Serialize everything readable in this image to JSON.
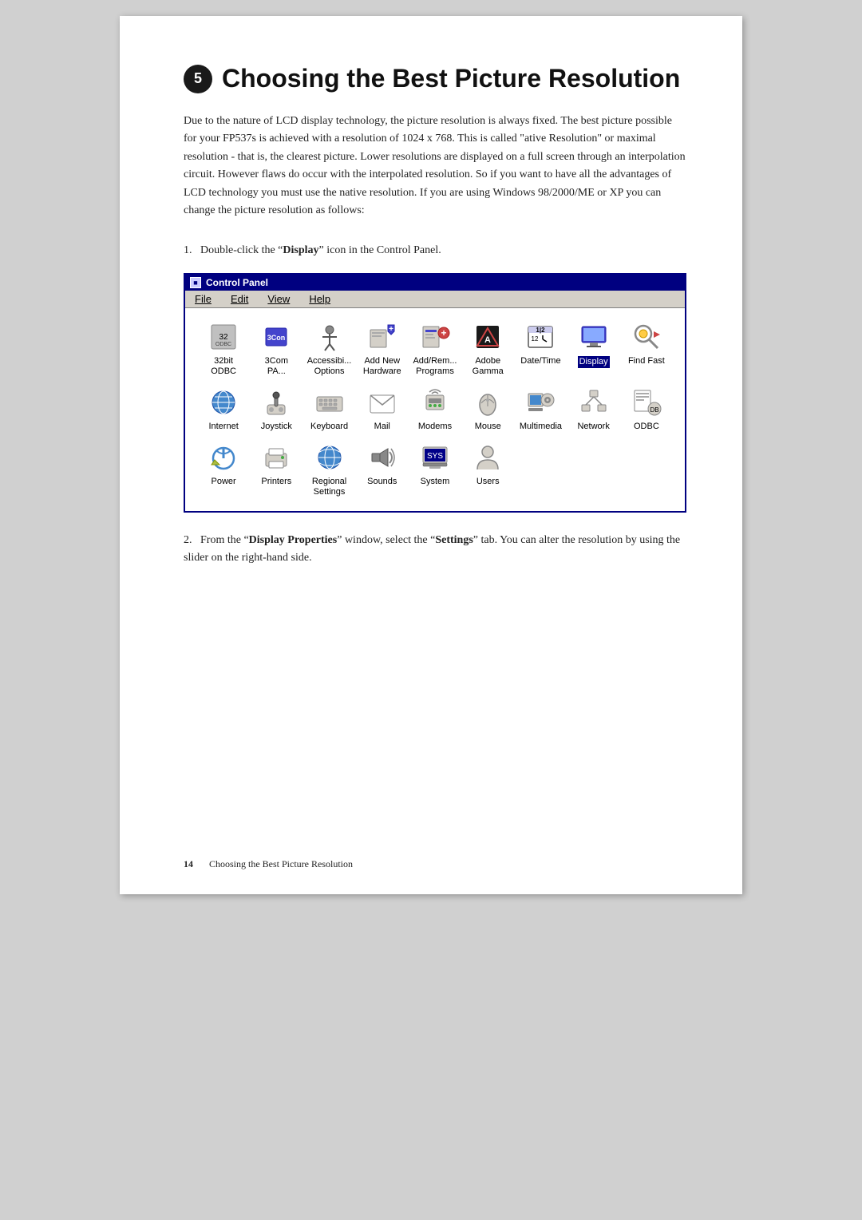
{
  "page": {
    "title": "Choosing the Best Picture Resolution",
    "chapter_num": "5",
    "footer_pagenum": "14",
    "footer_title": "Choosing the Best Picture Resolution"
  },
  "intro": {
    "text": "Due to the nature of  LCD display technology, the picture resolution is always fixed. The best picture possible for your FP537s is achieved with a resolution of 1024 x 768. This is called \"ative Resolution\" or maximal resolution - that is, the clearest picture. Lower resolutions are displayed on a full screen through an interpolation circuit. However flaws do occur with the interpolated resolution. So if you want to have all the advantages of LCD technology you must use the native resolution. If you are using Windows 98/2000/ME or XP you can change the picture resolution as follows:"
  },
  "steps": [
    {
      "num": "1.",
      "text_before": "Double-click the “",
      "bold": "Display",
      "text_after": "” icon in the Control Panel."
    },
    {
      "num": "2.",
      "text_before": "From the “",
      "bold1": "Display Properties",
      "text_mid": "” window, select the “",
      "bold2": "Settings",
      "text_after": "” tab. You can alter the resolution by using the slider on the right-hand side."
    }
  ],
  "control_panel": {
    "title": "Control Panel",
    "menu": [
      "File",
      "Edit",
      "View",
      "Help"
    ],
    "icons": [
      {
        "label": "32bit\nODBC",
        "icon_type": "odbcA"
      },
      {
        "label": "3Com\nPA...",
        "icon_type": "3com"
      },
      {
        "label": "Accessibi...\nOptions",
        "icon_type": "accessibility"
      },
      {
        "label": "Add New\nHardware",
        "icon_type": "addnew"
      },
      {
        "label": "Add/Rem...\nPrograms",
        "icon_type": "addrem"
      },
      {
        "label": "Adobe\nGamma",
        "icon_type": "adobe"
      },
      {
        "label": "Date/Time",
        "icon_type": "datetime"
      },
      {
        "label": "Display",
        "icon_type": "display",
        "highlight": true
      },
      {
        "label": "Find Fast",
        "icon_type": "findfast"
      },
      {
        "label": "Internet",
        "icon_type": "internet"
      },
      {
        "label": "Joystick",
        "icon_type": "joystick"
      },
      {
        "label": "Keyboard",
        "icon_type": "keyboard"
      },
      {
        "label": "Mail",
        "icon_type": "mail"
      },
      {
        "label": "Modems",
        "icon_type": "modems"
      },
      {
        "label": "Mouse",
        "icon_type": "mouse"
      },
      {
        "label": "Multimedia",
        "icon_type": "multimedia"
      },
      {
        "label": "Network",
        "icon_type": "network"
      },
      {
        "label": "ODBC",
        "icon_type": "odbc"
      },
      {
        "label": "Power",
        "icon_type": "power"
      },
      {
        "label": "Printers",
        "icon_type": "printers"
      },
      {
        "label": "Regional\nSettings",
        "icon_type": "regional"
      },
      {
        "label": "Sounds",
        "icon_type": "sounds"
      },
      {
        "label": "System",
        "icon_type": "system"
      },
      {
        "label": "Users",
        "icon_type": "users"
      }
    ]
  }
}
